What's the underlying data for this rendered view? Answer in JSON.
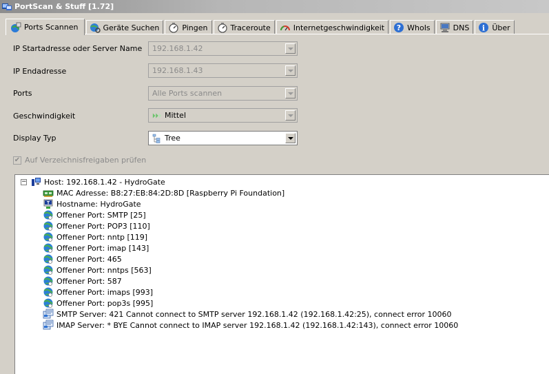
{
  "window": {
    "title": "PortScan & Stuff [1.72]"
  },
  "tabs": [
    {
      "label": "Ports Scannen",
      "icon": "ports-scan-icon",
      "active": true
    },
    {
      "label": "Geräte Suchen",
      "icon": "globe-search-icon"
    },
    {
      "label": "Pingen",
      "icon": "stopwatch-icon"
    },
    {
      "label": "Traceroute",
      "icon": "stopwatch-icon"
    },
    {
      "label": "Internetgeschwindigkeit",
      "icon": "speedometer-icon"
    },
    {
      "label": "WhoIs",
      "icon": "help-icon"
    },
    {
      "label": "DNS",
      "icon": "dns-icon"
    },
    {
      "label": "Über",
      "icon": "info-icon"
    }
  ],
  "form": {
    "start_label": "IP Startadresse oder Server Name",
    "start_value": "192.168.1.42",
    "end_label": "IP Endadresse",
    "end_value": "192.168.1.43",
    "ports_label": "Ports",
    "ports_value": "Alle Ports scannen",
    "speed_label": "Geschwindigkeit",
    "speed_value": "Mittel",
    "display_label": "Display Typ",
    "display_value": "Tree",
    "share_checkbox_label": "Auf Verzeichnisfreigaben prüfen",
    "share_checked": true
  },
  "tree": {
    "host": "Host: 192.168.1.42 - HydroGate",
    "items": [
      {
        "text": "MAC Adresse: B8:27:EB:84:2D:8D [Raspberry Pi Foundation]",
        "icon": "network-card-icon"
      },
      {
        "text": "Hostname: HydroGate",
        "icon": "hostname-icon"
      },
      {
        "text": "Offener Port: SMTP [25]",
        "icon": "globe-icon"
      },
      {
        "text": "Offener Port: POP3 [110]",
        "icon": "globe-icon"
      },
      {
        "text": "Offener Port: nntp [119]",
        "icon": "globe-icon"
      },
      {
        "text": "Offener Port: imap [143]",
        "icon": "globe-icon"
      },
      {
        "text": "Offener Port: 465",
        "icon": "globe-icon"
      },
      {
        "text": "Offener Port: nntps [563]",
        "icon": "globe-icon"
      },
      {
        "text": "Offener Port: 587",
        "icon": "globe-icon"
      },
      {
        "text": "Offener Port: imaps [993]",
        "icon": "globe-icon"
      },
      {
        "text": "Offener Port: pop3s [995]",
        "icon": "globe-icon"
      },
      {
        "text": "SMTP Server: 421 Cannot connect to SMTP server 192.168.1.42 (192.168.1.42:25), connect error 10060",
        "icon": "server-icon"
      },
      {
        "text": "IMAP Server: * BYE Cannot connect to IMAP server 192.168.1.42 (192.168.1.42:143), connect error 10060",
        "icon": "server-icon"
      }
    ]
  },
  "colors": {
    "titlebar": "#8d8d8d",
    "panel": "#d4d0c8",
    "disabled_text": "#8a8a8a"
  }
}
